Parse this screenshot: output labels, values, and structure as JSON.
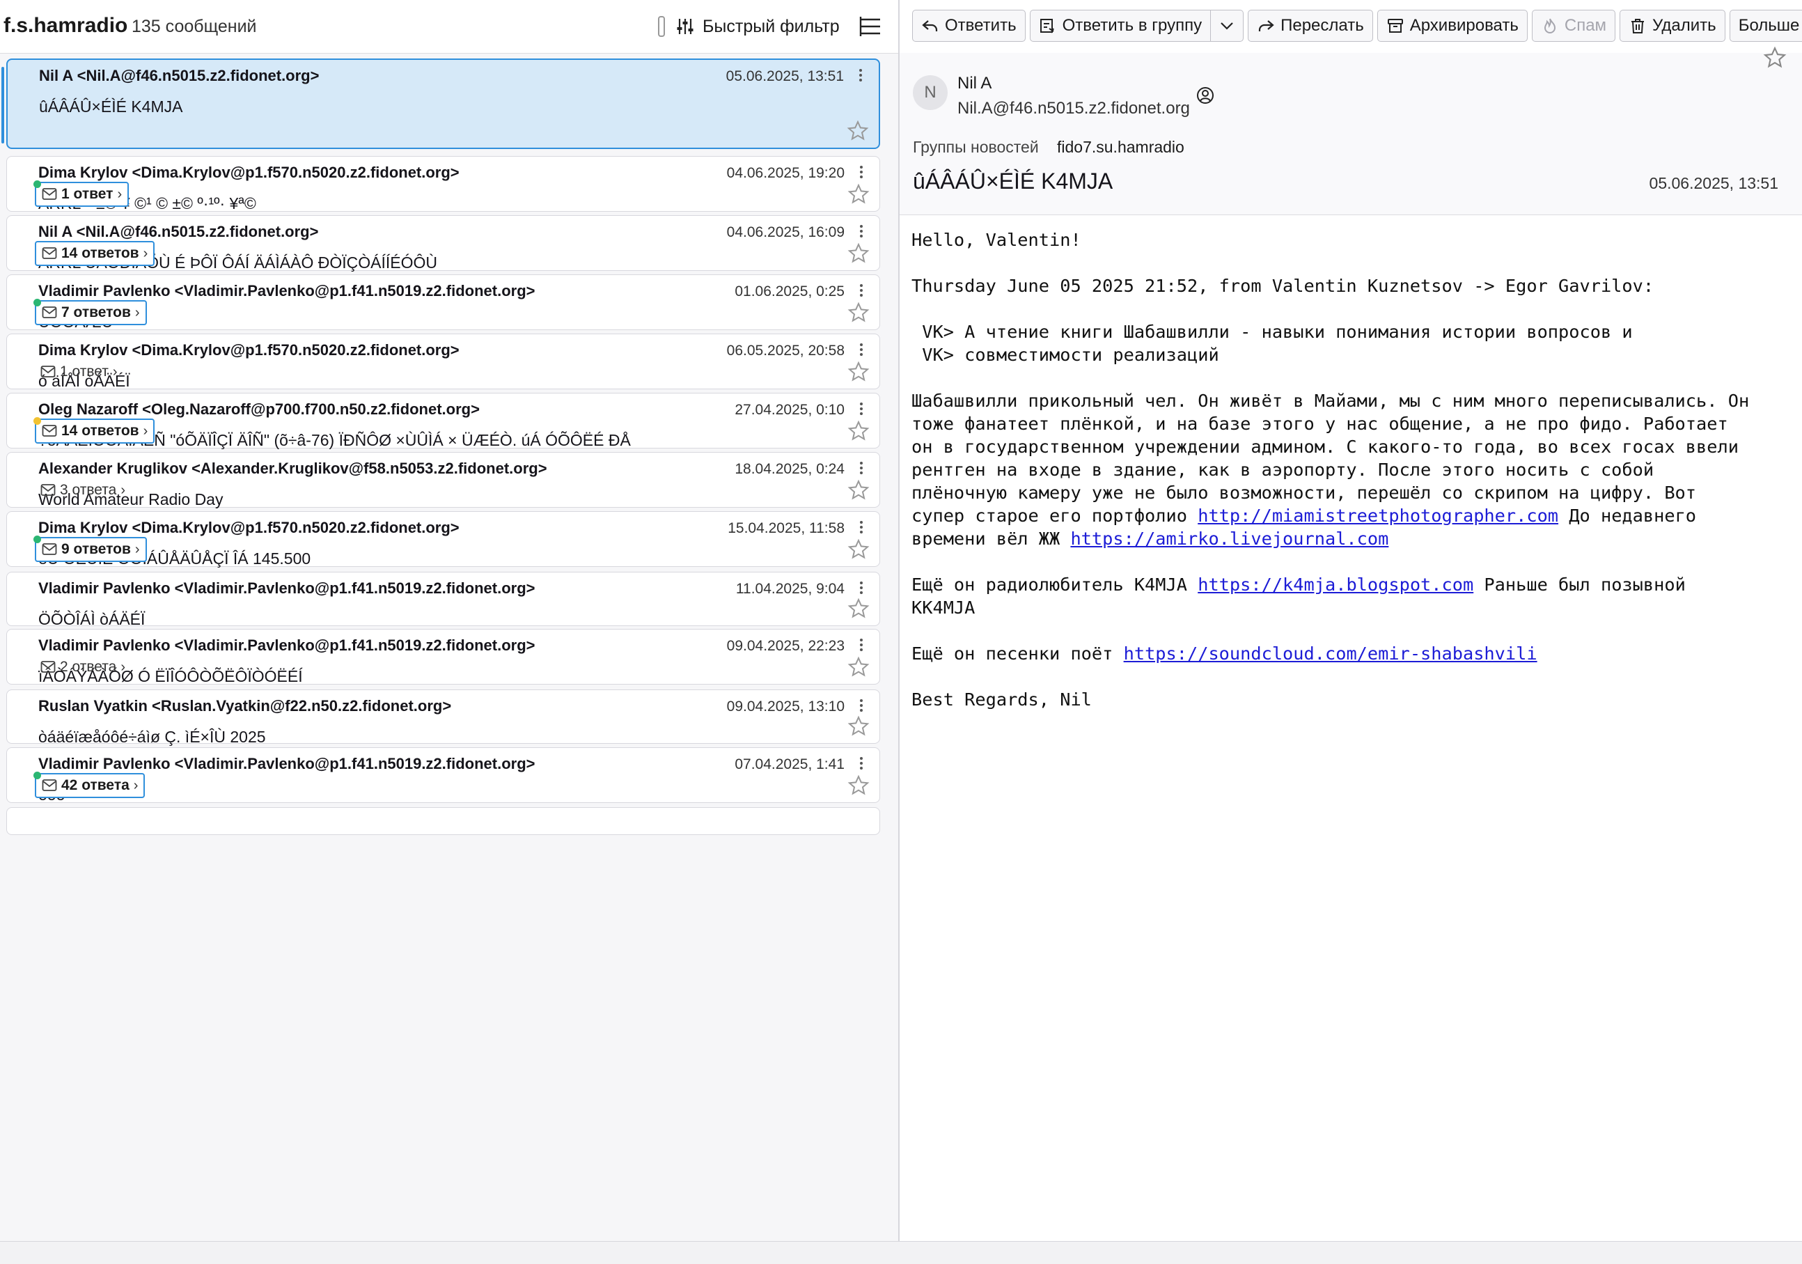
{
  "folder": {
    "name": "f.s.hamradio",
    "count": "135 сообщений"
  },
  "quick_filter_label": "Быстрый фильтр",
  "messages": [
    {
      "sender": "Nil A <Nil.A@f46.n5015.z2.fidonet.org>",
      "date": "05.06.2025, 13:51",
      "subject": "ûÁÂÁÛ×ÉÌÉ K4MJA",
      "replies": "",
      "selected": true
    },
    {
      "sender": "Dima Krylov <Dima.Krylov@p1.f570.n5020.z2.fidonet.org>",
      "date": "04.06.2025, 19:20",
      "subject": "ARRL ·º±© ¥ ©¹ © ±© º·¹º· ¥ª©",
      "replies": "1 ответ",
      "boxed": true,
      "dot": "green"
    },
    {
      "sender": "Nil A <Nil.A@f46.n5015.z2.fidonet.org>",
      "date": "04.06.2025, 16:09",
      "subject": "ARRL ÚÁÒÐÌÁÕÙ É ÞÔÏ ÔÁÍ ÄÁÌÁÀÔ ÐÒÏÇÒÁÍÍÉÓÔÙ",
      "replies": "14 ответов",
      "boxed": true,
      "dot": "none"
    },
    {
      "sender": "Vladimir Pavlenko <Vladimir.Pavlenko@p1.f41.n5019.z2.fidonet.org>",
      "date": "01.06.2025, 0:25",
      "subject": "ÛÔÒÁÆÙ",
      "replies": "7 ответов",
      "boxed": true,
      "dot": "green"
    },
    {
      "sender": "Dima Krylov <Dima.Krylov@p1.f570.n5020.z2.fidonet.org>",
      "date": "06.05.2025, 20:58",
      "subject": "ó äÍÅÍ òÁÄÉÏ",
      "replies": "1 ответ",
      "boxed": false
    },
    {
      "sender": "Oleg Nazaroff <Oleg.Nazaroff@p700.f700.n50.z2.fidonet.org>",
      "date": "27.04.2025, 0:10",
      "subject": "?òÁÄÉÏÔÔÁÍÃÉÑ \"óÕÄÏÎÇÏ ÄÎÑ\" (õ÷â-76) ÏÐÑÔØ ×ÙÛÌÁ × ÜÆÉÒ. úÁ ÓÕÔËÉ ÐÅ",
      "replies": "14 ответов",
      "boxed": true,
      "dot": "yellow"
    },
    {
      "sender": "Alexander Kruglikov <Alexander.Kruglikov@f58.n5053.z2.fidonet.org>",
      "date": "18.04.2025, 0:24",
      "subject": "World Amateur Radio Day",
      "replies": "3 ответа",
      "boxed": false
    },
    {
      "sender": "Dima Krylov <Dima.Krylov@p1.f570.n5020.z2.fidonet.org>",
      "date": "15.04.2025, 11:58",
      "subject": "éÚ ÖÉÚÎÉ ÓÕÍÁÛÅÄÛÅÇÏ ÎÁ 145.500",
      "replies": "9 ответов",
      "boxed": true,
      "dot": "green"
    },
    {
      "sender": "Vladimir Pavlenko <Vladimir.Pavlenko@p1.f41.n5019.z2.fidonet.org>",
      "date": "11.04.2025, 9:04",
      "subject": "ÖÕÒÎÁÌ òÁÄÉÏ",
      "replies": "",
      "boxed": false
    },
    {
      "sender": "Vladimir Pavlenko <Vladimir.Pavlenko@p1.f41.n5019.z2.fidonet.org>",
      "date": "09.04.2025, 22:23",
      "subject": "ïÂÒÁÝÁÀÓØ Ó ËÏÎÓÔÒÕËÔÏÒÓËÉÍ",
      "replies": "2 ответа",
      "boxed": false
    },
    {
      "sender": "Ruslan Vyatkin <Ruslan.Vyatkin@f22.n50.z2.fidonet.org>",
      "date": "09.04.2025, 13:10",
      "subject": "òáäéïæåóôé÷áìø Ç. ìÉ×ÎÙ 2025",
      "replies": "",
      "boxed": false
    },
    {
      "sender": "Vladimir Pavlenko <Vladimir.Pavlenko@p1.f41.n5019.z2.fidonet.org>",
      "date": "07.04.2025, 1:41",
      "subject": "óòò",
      "replies": "42 ответа",
      "boxed": true,
      "dot": "green"
    }
  ],
  "toolbar": {
    "reply": "Ответить",
    "reply_group": "Ответить в группу",
    "forward": "Переслать",
    "archive": "Архивировать",
    "spam": "Спам",
    "delete": "Удалить",
    "more": "Больше"
  },
  "message": {
    "avatar_letter": "N",
    "from_name": "Nil A",
    "from_email": "Nil.A@f46.n5015.z2.fidonet.org",
    "newsgroups_label": "Группы новостей",
    "newsgroups_value": "fido7.su.hamradio",
    "subject": "ûÁÂÁÛ×ÉÌÉ K4MJA",
    "date": "05.06.2025, 13:51",
    "body": {
      "l1": "Hello, Valentin!",
      "l2": "Thursday June 05 2025 21:52, from Valentin Kuznetsov -> Egor Gavrilov:",
      "l3": " VK> А чтение книги Шабашвилли - навыки понимания истории вопросов и",
      "l4": " VK> совместимости реализаций",
      "p1": "Шабашвилли прикольный чел. Он живёт в Майами, мы с ним много переписывались. Он\nтоже фанатеет плёнкой, и на базе этого у нас общение, а не про фидо. Работает\nон в государственном учреждении админом. С какого-то года, во всех госах ввели\nрентген на входе в здание, как в аэропорту. После этого носить с собой\nплёночную камеру уже не было возможности, перешёл со скрипом на цифру. Вот\nсупер старое его портфолио ",
      "link1": "http://miamistreetphotographer.com",
      "p1b": " До недавнего\nвремени вёл ЖЖ ",
      "link2": "https://amirko.livejournal.com",
      "p2": "Ещё он радиолюбитель K4MJA ",
      "link3": "https://k4mja.blogspot.com",
      "p2b": " Раньше был позывной\nKK4MJA",
      "p3": "Ещё он песенки поёт ",
      "link4": "https://soundcloud.com/emir-shabashvili",
      "sig": "Best Regards, Nil"
    }
  }
}
